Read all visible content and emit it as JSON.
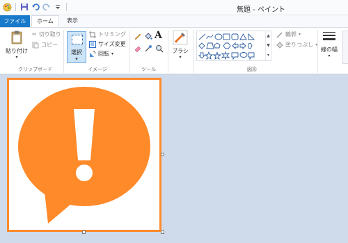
{
  "window": {
    "title": "無題 - ペイント"
  },
  "qat": {
    "icons": [
      "paint-app-icon",
      "save-icon",
      "undo-icon",
      "redo-icon",
      "customize-qat-icon"
    ]
  },
  "tabs": {
    "file": "ファイル",
    "home": "ホーム",
    "view": "表示",
    "active": "home"
  },
  "clipboard": {
    "paste": "貼り付け",
    "cut": "切り取り",
    "copy": "コピー",
    "group": "クリップボード"
  },
  "image": {
    "select": "選択",
    "crop": "トリミング",
    "resize": "サイズ変更",
    "rotate": "回転",
    "group": "イメージ"
  },
  "tools": {
    "group": "ツール"
  },
  "brushes": {
    "label": "ブラシ"
  },
  "shapes": {
    "outline": "輪郭",
    "fill": "塗りつぶし",
    "group": "図形"
  },
  "size": {
    "label": "線の幅"
  },
  "colors": {
    "accent": "#1979ca",
    "canvas_border": "#ff8a2a",
    "drawing": "#ff8a2a"
  }
}
